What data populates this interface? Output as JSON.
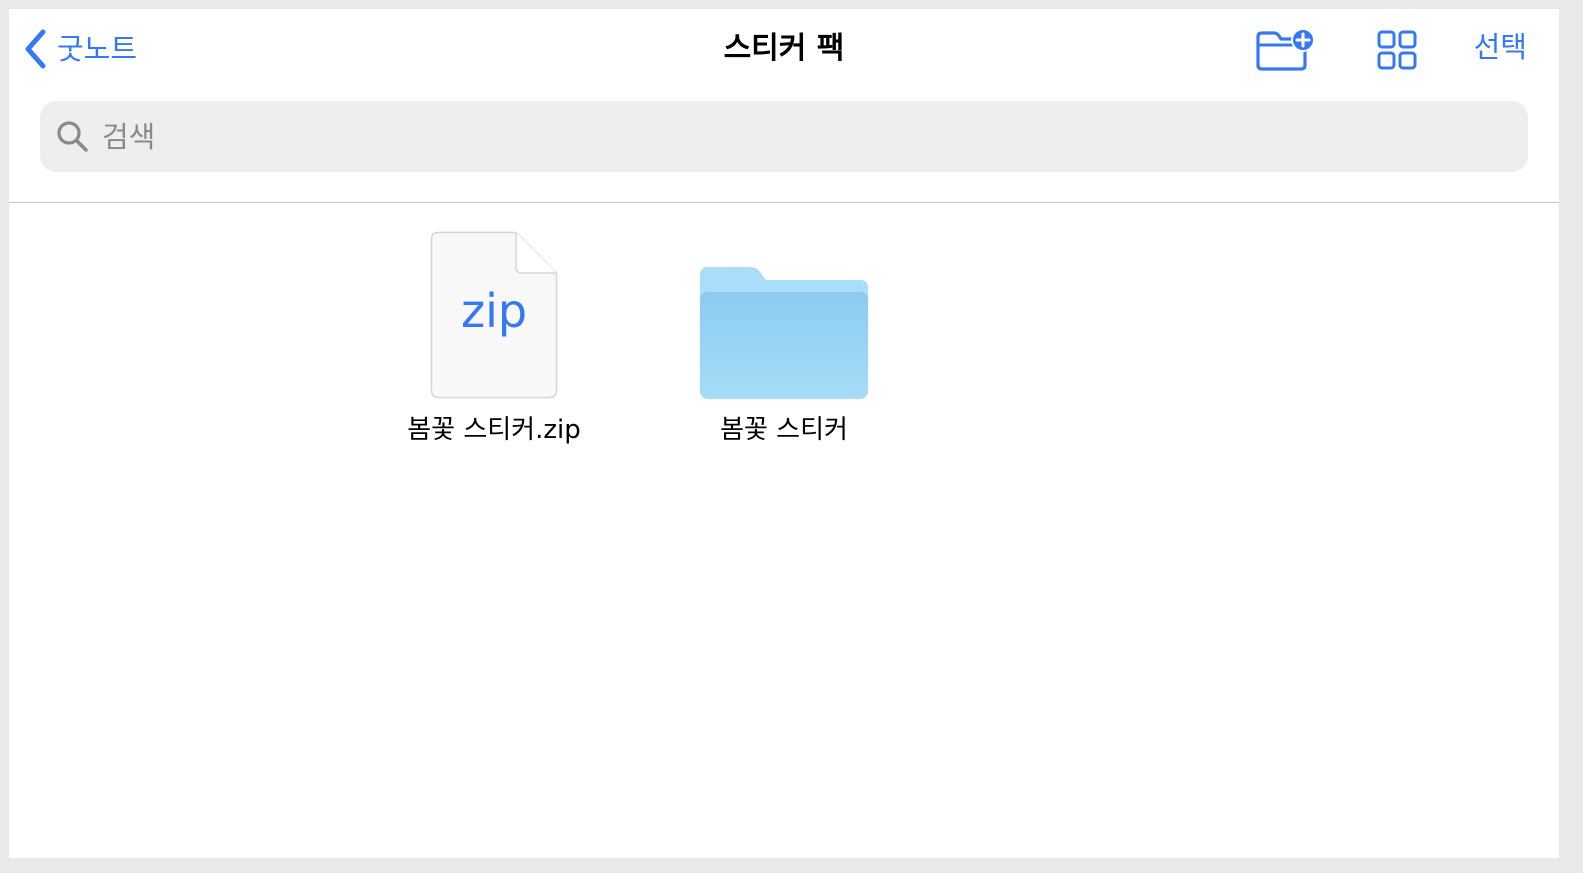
{
  "nav": {
    "back_label": "굿노트",
    "title": "스티커 팩",
    "select_label": "선택"
  },
  "search": {
    "placeholder": "검색"
  },
  "items": [
    {
      "name": "봄꽃 스티커.zip",
      "kind": "zip",
      "badge": "zip"
    },
    {
      "name": "봄꽃 스티커",
      "kind": "folder"
    }
  ],
  "colors": {
    "accent": "#3478f6",
    "folder": "#9fd7f7",
    "search_bg": "#eeeef0"
  },
  "icons": {
    "back": "chevron-left-icon",
    "new_folder": "folder-plus-icon",
    "view": "grid-view-icon",
    "search": "magnifier-icon"
  }
}
